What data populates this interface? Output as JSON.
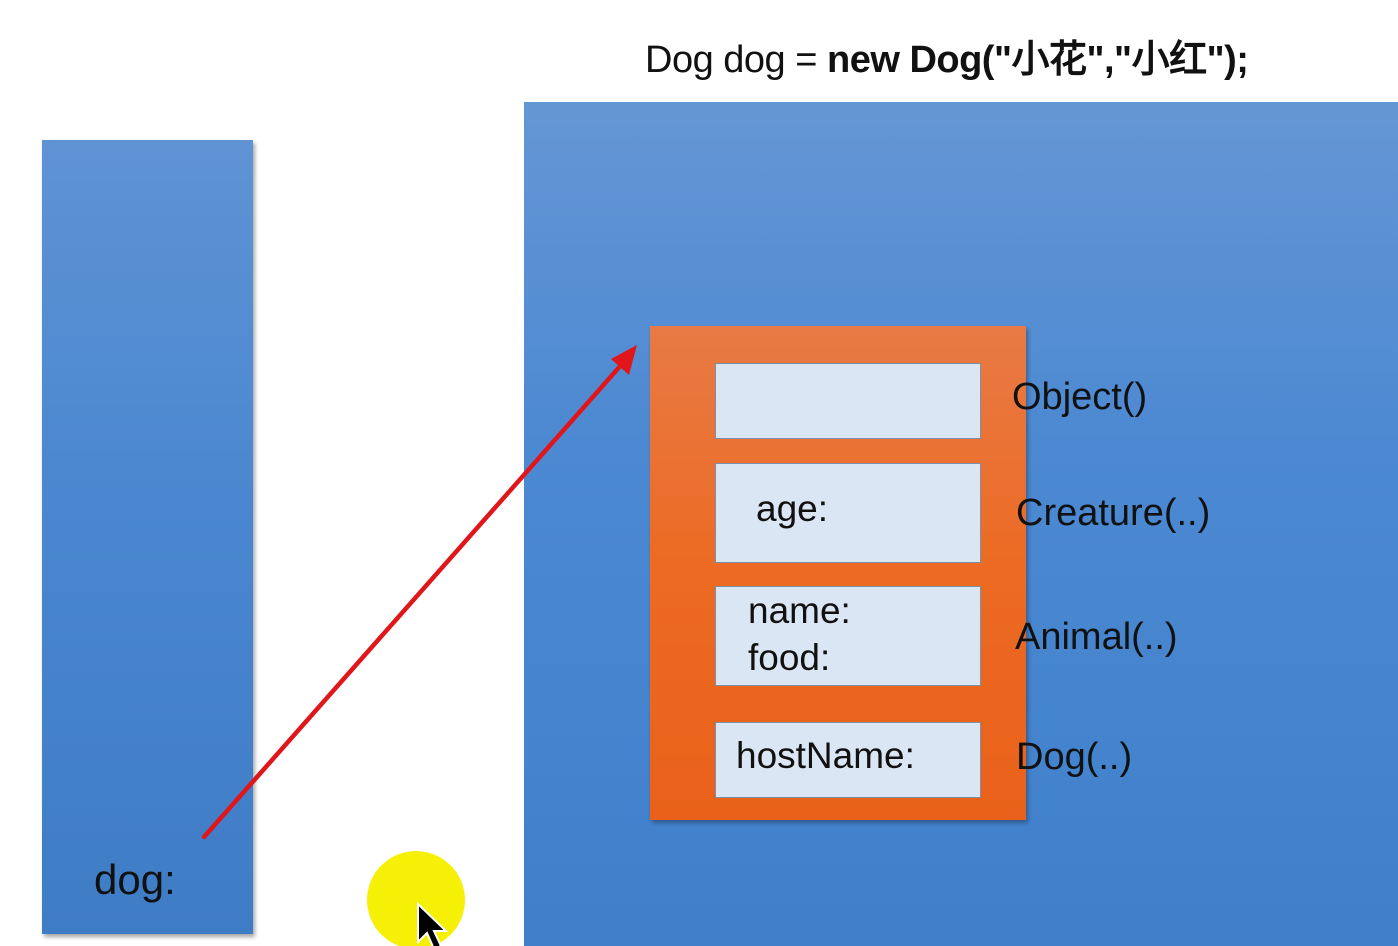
{
  "code": {
    "prefix": "Dog dog = ",
    "bold_part": "new Dog(\"小花\",\"小红\");"
  },
  "stack": {
    "variable_label": "dog:"
  },
  "heap": {
    "segments": {
      "object": {
        "text": ""
      },
      "creature": {
        "line1": "age:"
      },
      "animal": {
        "line1": "name:",
        "line2": "food:"
      },
      "dog": {
        "line1": "hostName:"
      }
    },
    "constructor_labels": {
      "object": "Object()",
      "creature": "Creature(..)",
      "animal": "Animal(..)",
      "dog": "Dog(..)"
    }
  },
  "colors": {
    "stack_blue": "#4a87d0",
    "heap_blue": "#4c89d2",
    "object_orange": "#ec6a22",
    "field_fill": "#dbe6f4",
    "arrow_red": "#e0161b",
    "cursor_highlight": "#f5f005"
  },
  "icons": {
    "reference_arrow": "arrow-icon",
    "mouse_pointer": "cursor-icon"
  }
}
